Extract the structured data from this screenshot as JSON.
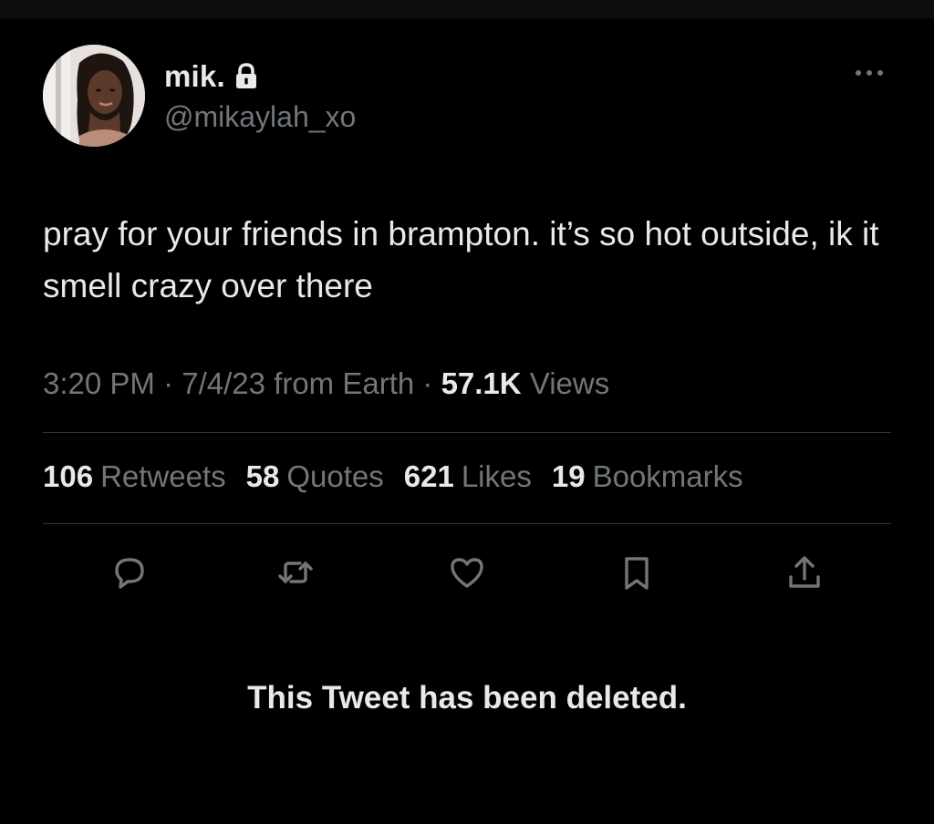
{
  "author": {
    "display_name": "mik.",
    "handle": "@mikaylah_xo",
    "protected_icon": "lock-icon",
    "avatar": "avatar-photo"
  },
  "tweet": {
    "text": "pray for your friends in brampton. it’s so hot outside, ik it smell crazy over there",
    "time": "3:20 PM",
    "date": "7/4/23",
    "source": "from Earth",
    "separator": "·",
    "views_count": "57.1K",
    "views_label": "Views"
  },
  "stats": [
    {
      "count": "106",
      "label": "Retweets"
    },
    {
      "count": "58",
      "label": "Quotes"
    },
    {
      "count": "621",
      "label": "Likes"
    },
    {
      "count": "19",
      "label": "Bookmarks"
    }
  ],
  "actions": [
    {
      "name": "reply",
      "icon": "reply-icon"
    },
    {
      "name": "retweet",
      "icon": "retweet-icon"
    },
    {
      "name": "like",
      "icon": "heart-icon"
    },
    {
      "name": "bookmark",
      "icon": "bookmark-icon"
    },
    {
      "name": "share",
      "icon": "share-icon"
    }
  ],
  "notice": "This Tweet has been deleted.",
  "colors": {
    "background": "#000000",
    "primary_text": "#e7e9ea",
    "secondary_text": "#71767b",
    "divider": "#2f3336"
  }
}
